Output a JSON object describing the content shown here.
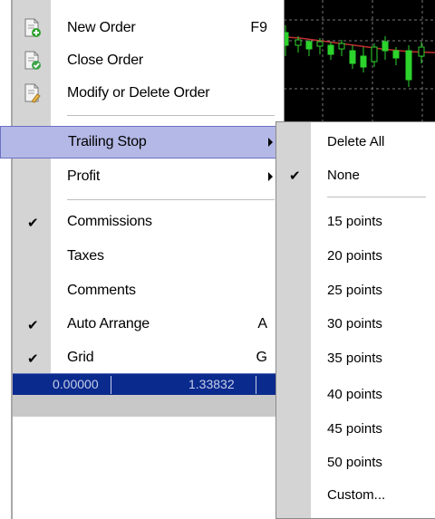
{
  "main_menu": {
    "items": [
      {
        "label": "New Order",
        "accel": "F9",
        "icon": "new-order-icon"
      },
      {
        "label": "Close Order",
        "icon": "close-order-icon"
      },
      {
        "label": "Modify or Delete Order",
        "icon": "modify-order-icon"
      },
      {
        "label": "Trailing Stop",
        "submenu": true,
        "highlighted": true
      },
      {
        "label": "Profit",
        "submenu": true
      },
      {
        "label": "Commissions",
        "checked": true
      },
      {
        "label": "Taxes"
      },
      {
        "label": "Comments"
      },
      {
        "label": "Auto Arrange",
        "accel": "A",
        "checked": true
      },
      {
        "label": "Grid",
        "accel": "G",
        "checked": true
      }
    ]
  },
  "check_glyph": "✔",
  "trailing_stop_submenu": {
    "items": [
      {
        "label": "Delete All"
      },
      {
        "label": "None",
        "checked": true
      },
      {
        "label": "15 points"
      },
      {
        "label": "20 points"
      },
      {
        "label": "25 points"
      },
      {
        "label": "30 points"
      },
      {
        "label": "35 points"
      },
      {
        "label": "40 points"
      },
      {
        "label": "45 points"
      },
      {
        "label": "50 points"
      },
      {
        "label": "Custom..."
      }
    ]
  },
  "terminal_row": {
    "value_1": "0.00000",
    "value_2": "1.33832"
  },
  "colors": {
    "highlight_bg": "#b4b8e6",
    "gutter": "#d4d4d4",
    "terminal_row": "#0a2a8e",
    "chart_bg": "#000000",
    "candle_green": "#2cd32c",
    "ma_red": "#c03030"
  }
}
